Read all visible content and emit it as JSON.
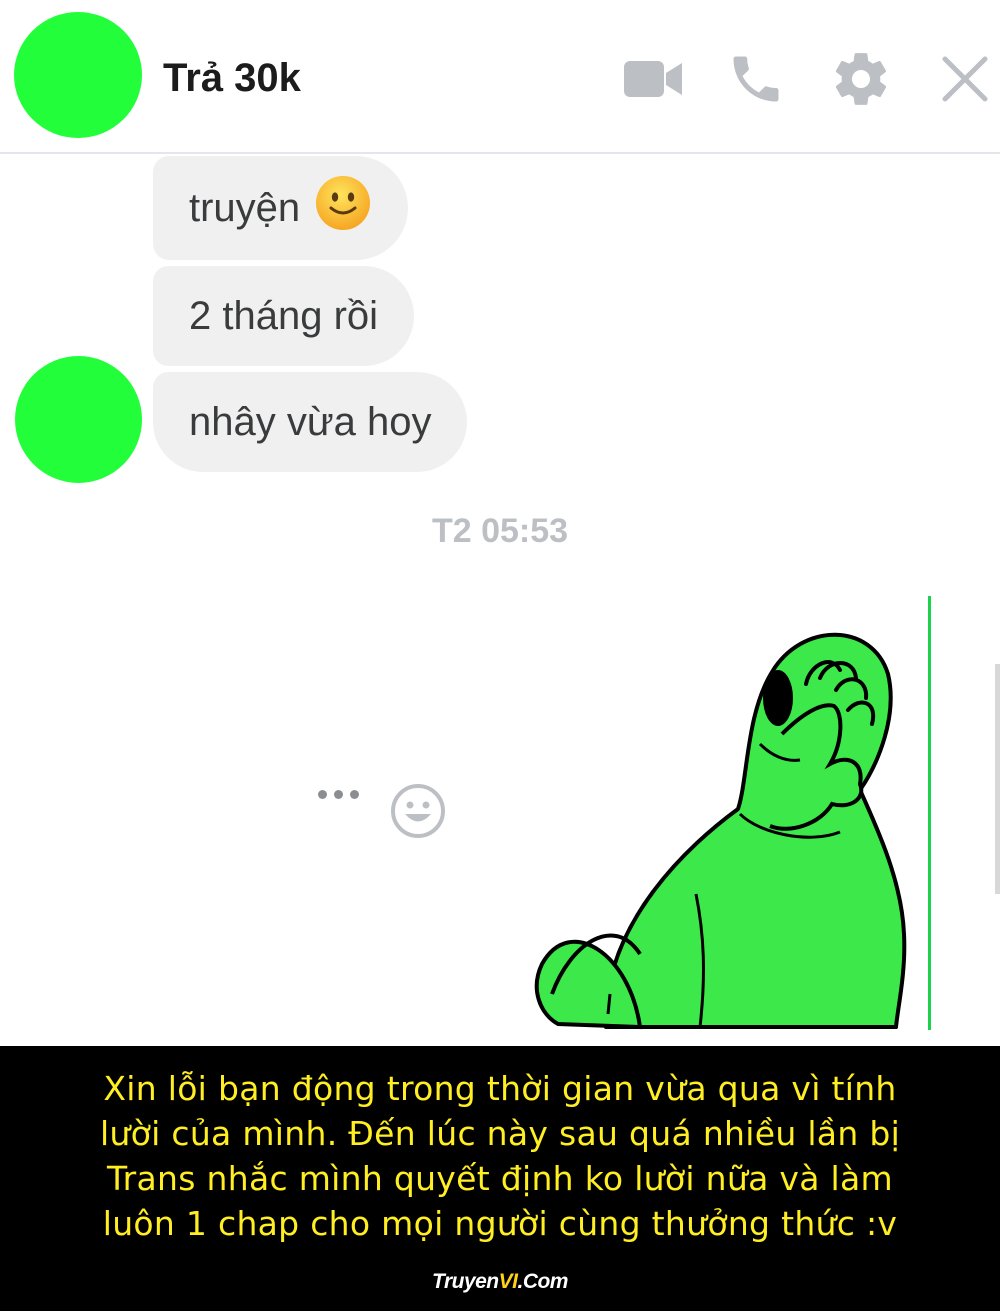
{
  "header": {
    "title": "Trả 30k",
    "icons": [
      "video-camera-icon",
      "phone-icon",
      "gear-icon",
      "close-icon"
    ],
    "avatar_color": "#22ff3a"
  },
  "messages": [
    {
      "text": "truyện",
      "emoji": "slightly-smiling-face-emoji"
    },
    {
      "text": "2 tháng rồi"
    },
    {
      "text": "nhây vừa hoy"
    }
  ],
  "timestamp": "T2 05:53",
  "message_actions": [
    "more-options-icon",
    "reaction-smiley-icon"
  ],
  "sticker": {
    "name": "facepalm-alien-sticker",
    "color": "#3de84a"
  },
  "banner": {
    "note_lines": [
      "Xin lỗi bạn động trong thời gian vừa qua vì tính",
      "lười của mình. Đến lúc này sau quá nhiều lần bị",
      "Trans nhắc mình quyết định ko lười nữa và làm",
      "luôn 1 chap cho mọi người cùng thưởng thức :v"
    ],
    "brand_prefix": "Truyen",
    "brand_accent": "VI",
    "brand_suffix": ".Com",
    "text_color": "#ffee22",
    "background": "#000000"
  }
}
